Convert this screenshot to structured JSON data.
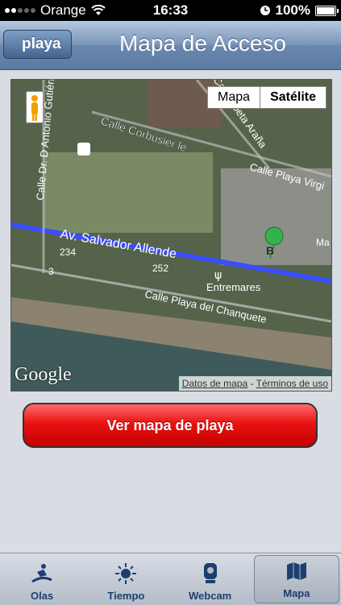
{
  "status": {
    "carrier": "Orange",
    "time": "16:33",
    "battery": "100%"
  },
  "nav": {
    "back": "playa",
    "title": "Mapa de Acceso"
  },
  "map": {
    "type_options": [
      "Mapa",
      "Satélite"
    ],
    "selected_type": "Satélite",
    "logo": "Google",
    "footer_data": "Datos de mapa",
    "footer_sep": " - ",
    "footer_terms": "Términos de uso",
    "marker": "B",
    "streets": {
      "corbusier": "Calle Corbusier le",
      "antonio": "Calle Dr. D Antonio Gutiérr",
      "arana": "Calle Poeta Araña",
      "virgi": "Calle Playa Virgi",
      "salvador": "Av. Salvador Allende",
      "chanquete": "Calle Playa del Chanquete",
      "entremares": "Entremares",
      "n234": "234",
      "n252": "252",
      "n3": "3",
      "ma": "Ma"
    }
  },
  "action": {
    "label": "Ver mapa de playa"
  },
  "tabs": [
    {
      "label": "Olas",
      "icon": "surfer-icon"
    },
    {
      "label": "Tiempo",
      "icon": "sun-icon"
    },
    {
      "label": "Webcam",
      "icon": "webcam-icon"
    },
    {
      "label": "Mapa",
      "icon": "map-icon"
    }
  ],
  "colors": {
    "accent": "#d90000",
    "nav": "#6b88ae",
    "route": "#3a4dff"
  }
}
